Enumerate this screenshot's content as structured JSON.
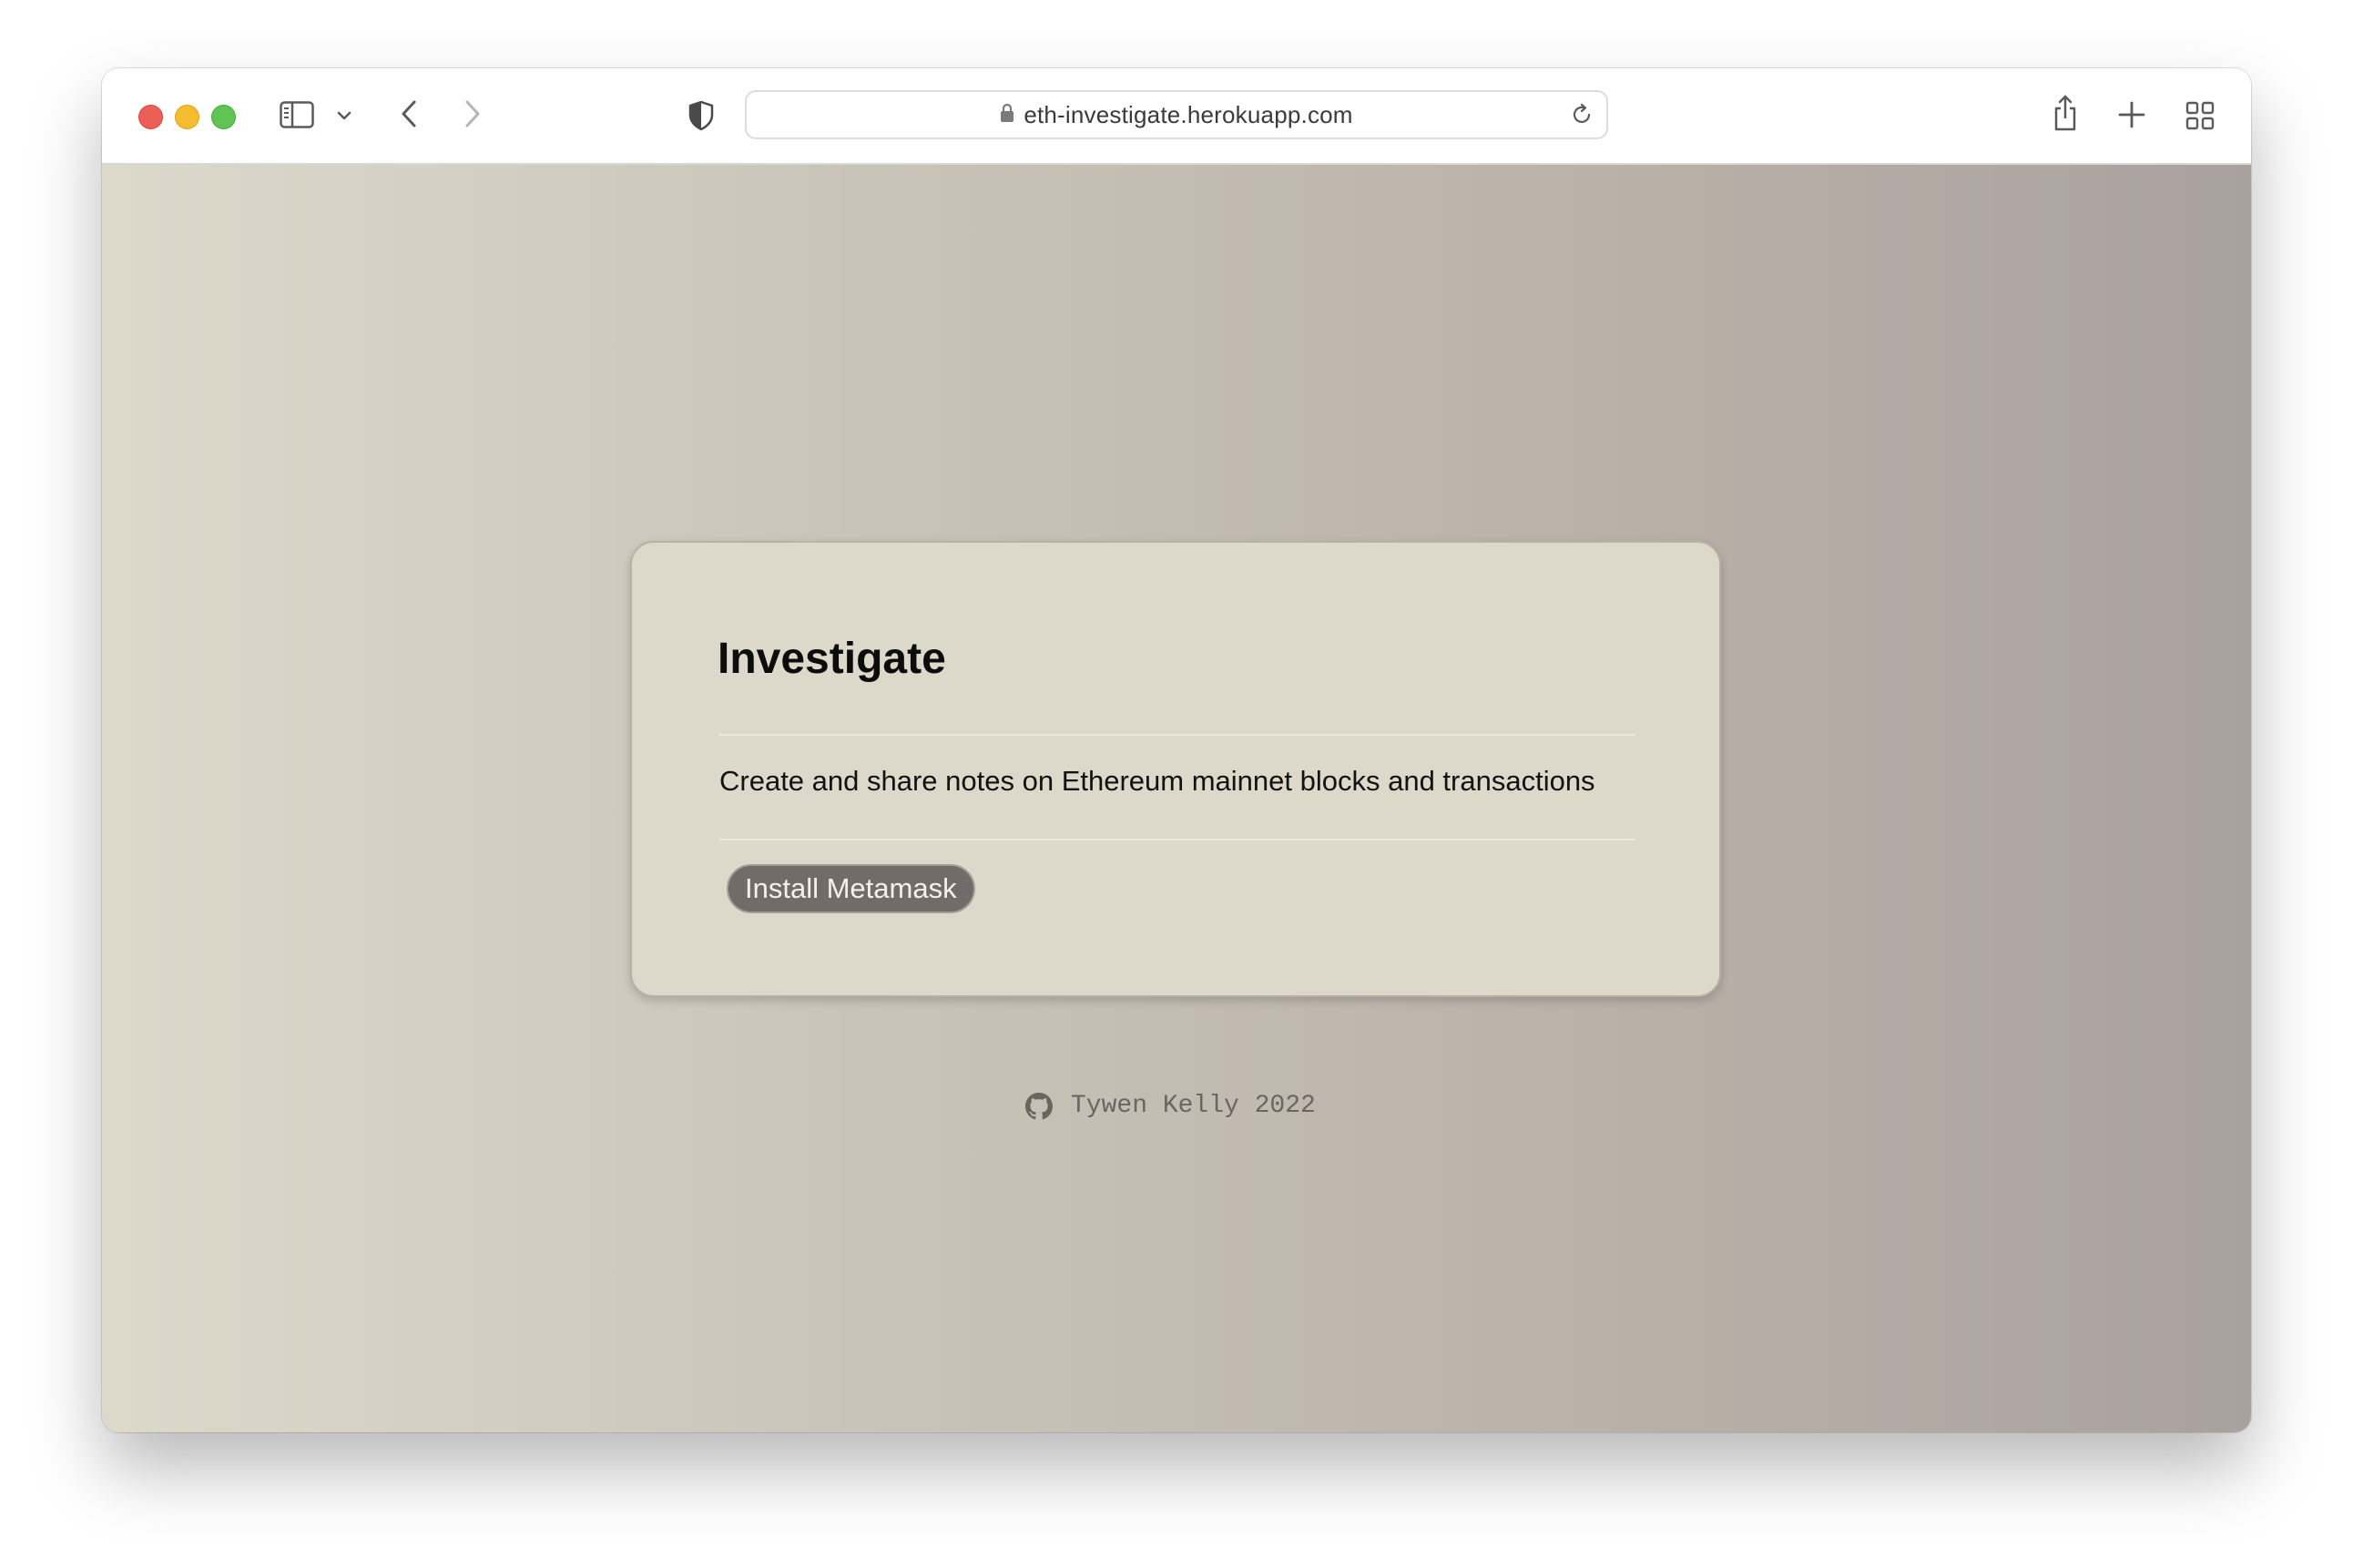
{
  "browser": {
    "url": "eth-investigate.herokuapp.com",
    "icons": {
      "close": "close-dot",
      "minimize": "minimize-dot",
      "maximize": "maximize-dot",
      "sidebar": "sidebar-icon",
      "sidebar_menu": "chevron-down-icon",
      "back": "back-icon",
      "forward": "forward-icon",
      "privacy": "shield-icon",
      "lock": "lock-icon",
      "reload": "reload-icon",
      "share": "share-icon",
      "new_tab": "plus-icon",
      "tab_overview": "grid-icon"
    }
  },
  "card": {
    "title": "Investigate",
    "description": "Create and share notes on Ethereum mainnet blocks and transactions",
    "button_label": "Install Metamask"
  },
  "footer": {
    "icon": "github-icon",
    "text": "Tywen Kelly 2022"
  },
  "colors": {
    "background_gradient_start": "#dcd9cb",
    "background_gradient_end": "#a9a19e",
    "card_background": "#dcd9cb",
    "button_background": "#726c68",
    "button_text": "#f4f1ec"
  }
}
